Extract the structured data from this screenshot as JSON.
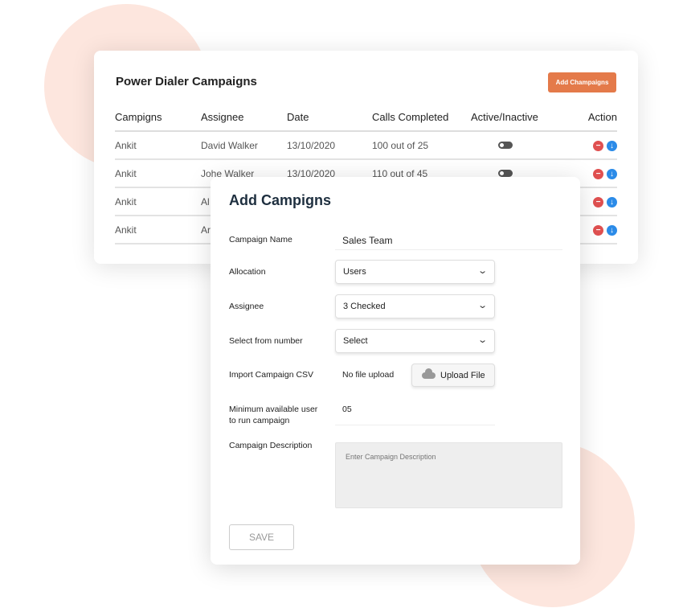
{
  "campaigns_card": {
    "title": "Power Dialer Campaigns",
    "add_button": "Add Champaigns",
    "columns": [
      "Campigns",
      "Assignee",
      "Date",
      "Calls Completed",
      "Active/Inactive",
      "Action"
    ],
    "rows": [
      {
        "campaign": "Ankit",
        "assignee": "David Walker",
        "date": "13/10/2020",
        "calls": "100 out of 25",
        "active": false
      },
      {
        "campaign": "Ankit",
        "assignee": "Johe Walker",
        "date": "13/10/2020",
        "calls": "110 out of 45",
        "active": false
      },
      {
        "campaign": "Ankit",
        "assignee": "Al",
        "date": "",
        "calls": "",
        "active": false
      },
      {
        "campaign": "Ankit",
        "assignee": "Ar",
        "date": "",
        "calls": "",
        "active": false
      }
    ]
  },
  "modal": {
    "title": "Add Campigns",
    "campaign_name_label": "Campaign Name",
    "campaign_name_value": "Sales Team",
    "allocation_label": "Allocation",
    "allocation_value": "Users",
    "assignee_label": "Assignee",
    "assignee_value": "3 Checked",
    "from_number_label": "Select from number",
    "from_number_value": "Select",
    "csv_label": "Import Campaign CSV",
    "csv_status": "No file upload",
    "upload_button": "Upload File",
    "min_users_label_1": "Minimum available user",
    "min_users_label_2": "to run campaign",
    "min_users_value": "05",
    "description_label": "Campaign Description",
    "description_placeholder": "Enter Campaign Description",
    "save_button": "SAVE"
  },
  "colors": {
    "accent": "#e47a4a",
    "delete": "#e05050",
    "download": "#2b8be8",
    "background_circle": "#fde6de"
  }
}
